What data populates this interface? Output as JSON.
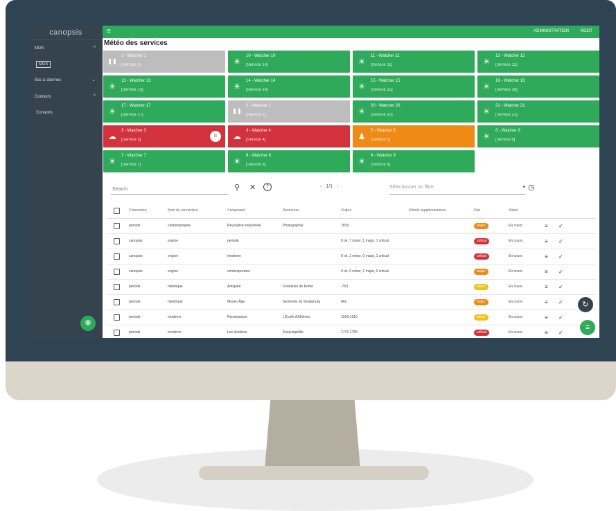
{
  "colors": {
    "green": "#2eaa5a",
    "grey": "#bdbdbd",
    "red": "#d2323b",
    "orange": "#ef8a16",
    "sidebar": "#34434e"
  },
  "app": {
    "logo": "canopsis",
    "page_title": "Météo des services",
    "admin_label": "ADMINISTRATION",
    "user_label": "ROOT"
  },
  "sidebar": {
    "mds_label": "MDS",
    "mds_sub_label": "MDS",
    "bac_label": "Bac à alarmes",
    "contexts_label": "Contexts",
    "contexts_sub_label": "Contexts"
  },
  "tiles": [
    {
      "name": "1 - Watcher 1",
      "service": "[Service 1]",
      "state": "grey",
      "icon": "pause-icon"
    },
    {
      "name": "10 - Watcher 10",
      "service": "[Service 10]",
      "state": "green",
      "icon": "sun-icon"
    },
    {
      "name": "11 - Watcher 11",
      "service": "[Service 11]",
      "state": "green",
      "icon": "sun-icon"
    },
    {
      "name": "12 - Watcher 12",
      "service": "[Service 12]",
      "state": "green",
      "icon": "sun-icon"
    },
    {
      "name": "13 - Watcher 13",
      "service": "[Service 13]",
      "state": "green",
      "icon": "sun-icon"
    },
    {
      "name": "14 - Watcher 14",
      "service": "[Service 14]",
      "state": "green",
      "icon": "sun-icon"
    },
    {
      "name": "15 - Watcher 15",
      "service": "[Service 15]",
      "state": "green",
      "icon": "sun-icon"
    },
    {
      "name": "16 - Watcher 16",
      "service": "[Service 16]",
      "state": "green",
      "icon": "sun-icon"
    },
    {
      "name": "17 - Watcher 17",
      "service": "[Service 17]",
      "state": "green",
      "icon": "sun-icon"
    },
    {
      "name": "2 - Watcher 2",
      "service": "[Service 2]",
      "state": "grey",
      "icon": "pause-icon"
    },
    {
      "name": "20 - Watcher 20",
      "service": "[Service 20]",
      "state": "green",
      "icon": "sun-icon"
    },
    {
      "name": "21 - Watcher 21",
      "service": "[Service 21]",
      "state": "green",
      "icon": "sun-icon"
    },
    {
      "name": "3 - Watcher 3",
      "service": "[Service 3]",
      "state": "red",
      "icon": "cloud-icon",
      "pause": "II"
    },
    {
      "name": "4 - Watcher 4",
      "service": "[Service 4]",
      "state": "red",
      "icon": "cloud-icon"
    },
    {
      "name": "5 - Watcher 5",
      "service": "[Service 5]",
      "state": "orange",
      "icon": "person-icon"
    },
    {
      "name": "6 - Watcher 6",
      "service": "[Service 6]",
      "state": "green",
      "icon": "sun-icon"
    },
    {
      "name": "7 - Watcher 7",
      "service": "[Service 7]",
      "state": "green",
      "icon": "sun-icon"
    },
    {
      "name": "8 - Watcher 8",
      "service": "[Service 8]",
      "state": "green",
      "icon": "sun-icon"
    },
    {
      "name": "9 - Watcher 9",
      "service": "[Service 9]",
      "state": "green",
      "icon": "sun-icon"
    }
  ],
  "toolbar": {
    "search_placeholder": "Search",
    "search_icon": "⚲",
    "clear_icon": "✕",
    "help_icon": "?",
    "prev": "‹",
    "page_label": "1/1",
    "next": "›",
    "filter_placeholder": "Sélectionner un filtre",
    "filter_caret": "▾",
    "history_icon": "◷"
  },
  "table": {
    "headers": [
      "Connecteur",
      "Nom du connecteur",
      "Composant",
      "Ressource",
      "Output",
      "Détails supplémentaires",
      "État",
      "Statut"
    ],
    "rows": [
      {
        "connector": "periode",
        "connector_name": "contemporaine",
        "component": "Révolution industrielle",
        "resource": "Photographie",
        "output": "1839",
        "state": "major",
        "state_color": "#ef8a16",
        "status": "En cours"
      },
      {
        "connector": "canopsis",
        "connector_name": "engine",
        "component": "periode",
        "resource": "",
        "output": "0 ok, 7 minor, 1 major, 1 critical",
        "state": "critical",
        "state_color": "#d2323b",
        "status": "En cours"
      },
      {
        "connector": "canopsis",
        "connector_name": "engine",
        "component": "moderne",
        "resource": "",
        "output": "0 ok, 1 minor, 0 major, 1 critical",
        "state": "critical",
        "state_color": "#d2323b",
        "status": "En cours"
      },
      {
        "connector": "canopsis",
        "connector_name": "engine",
        "component": "contemporaine",
        "resource": "",
        "output": "0 ok, 0 minor, 1 major, 0 critical",
        "state": "major",
        "state_color": "#ef8a16",
        "status": "En cours"
      },
      {
        "connector": "periode",
        "connector_name": "historique",
        "component": "Antiquité",
        "resource": "Fondation de Rome",
        "output": "-753",
        "state": "minor",
        "state_color": "#f1c21b",
        "status": "En cours"
      },
      {
        "connector": "periode",
        "connector_name": "historique",
        "component": "Moyen Âge",
        "resource": "Serments de Strasbourg",
        "output": "842",
        "state": "major",
        "state_color": "#ef8a16",
        "status": "En cours"
      },
      {
        "connector": "periode",
        "connector_name": "moderne",
        "component": "Renaissance",
        "resource": "L'École d'Athènes",
        "output": "1509-1510",
        "state": "minor",
        "state_color": "#f1c21b",
        "status": "En cours"
      },
      {
        "connector": "periode",
        "connector_name": "moderne",
        "component": "Les lumières",
        "resource": "Encyclopédie",
        "output": "1747-1765",
        "state": "critical",
        "state_color": "#d2323b",
        "status": "En cours"
      }
    ]
  },
  "fab": {
    "refresh_icon": "↻",
    "menu_icon": "≡",
    "settings_icon": "✻"
  }
}
